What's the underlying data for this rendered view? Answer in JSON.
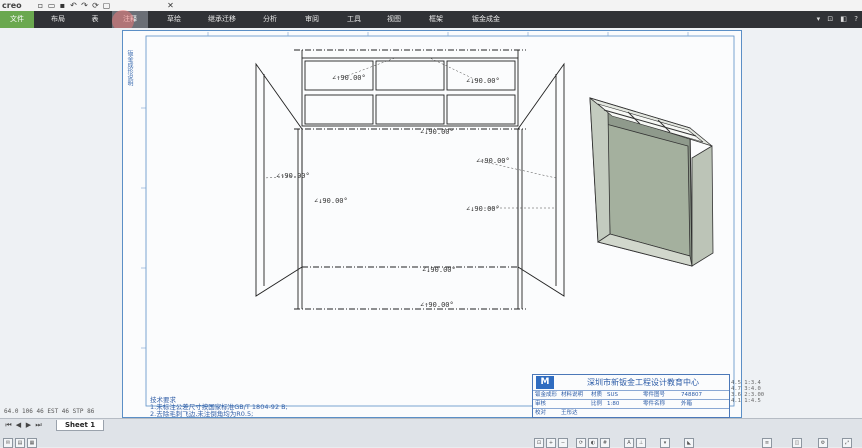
{
  "app": {
    "logo": "creo"
  },
  "quick_access": [
    {
      "icon": "new-icon",
      "glyph": "▫"
    },
    {
      "icon": "open-icon",
      "glyph": "▭"
    },
    {
      "icon": "save-icon",
      "glyph": "▪"
    },
    {
      "icon": "undo-icon",
      "glyph": "↶"
    },
    {
      "icon": "redo-icon",
      "glyph": "↷"
    },
    {
      "icon": "regenerate-icon",
      "glyph": "⟳"
    },
    {
      "icon": "window-icon",
      "glyph": "▢"
    },
    {
      "icon": "close-window-icon",
      "glyph": "✕"
    }
  ],
  "ribbon": {
    "tabs": [
      {
        "label": "文件"
      },
      {
        "label": "布局"
      },
      {
        "label": "表"
      },
      {
        "label": "注释"
      },
      {
        "label": "草绘"
      },
      {
        "label": "继承迁移"
      },
      {
        "label": "分析"
      },
      {
        "label": "审阅"
      },
      {
        "label": "工具"
      },
      {
        "label": "视图"
      },
      {
        "label": "框架"
      },
      {
        "label": "钣金成金"
      }
    ],
    "right_icons": [
      "▾",
      "⊡",
      "◧",
      "?"
    ]
  },
  "drawing": {
    "side_note": "钣金成形说明",
    "dimensions": {
      "angle_top_left": "∠↑90.00°",
      "angle_top_right": "∠↓90.00°",
      "angle_mid": "∠↓90.00°",
      "angle_right_1": "∠↑90.00°",
      "angle_left": "∠↑90.00°",
      "angle_left_2": "∠↓90.00°",
      "angle_right_2": "∠↓90.00°",
      "angle_bottom_1": "∠↓90.00°",
      "angle_bottom_2": "∠↑90.00°"
    }
  },
  "title_block": {
    "logo_letter": "M",
    "company": "深圳市新钣金工程设计教育中心",
    "row1": [
      "钣金成形",
      "材料说明",
      "材质",
      "SUS",
      "零件图号",
      "748807"
    ],
    "row2": [
      "审核",
      "",
      "比例",
      "1:80",
      "零件名称",
      "外箱"
    ],
    "row3": [
      "校对",
      "王彤达",
      "",
      "",
      "",
      ""
    ]
  },
  "notes": {
    "title": "技术要求",
    "line1": "1.未标注公差尺寸按国家标准GB/T 1804-92 B;",
    "line2": "2.去除毛刺飞边,未注倒角均为R0.5;"
  },
  "status": {
    "coords": "64.0 106  46 EST  46 STP 86",
    "sheet_tab": "Sheet 1",
    "right_readout": [
      "4.5   1:3.4",
      "4.7   3:4.0",
      "3.6   2:3.00",
      "4.1   1:4.5"
    ]
  }
}
